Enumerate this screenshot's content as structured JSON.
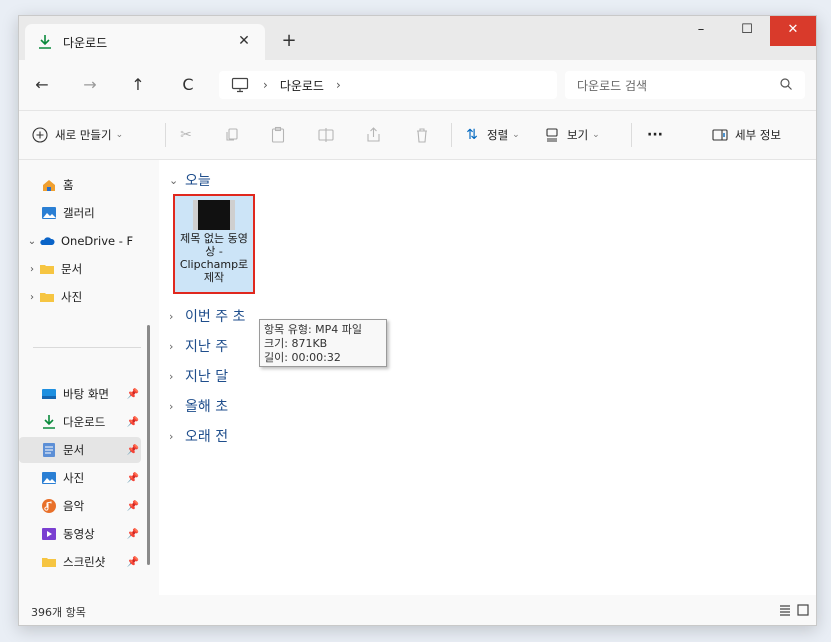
{
  "tab": {
    "title": "다운로드",
    "close": "✕",
    "new_tab": "+"
  },
  "window_controls": {
    "minimize": "–",
    "maximize": "☐",
    "close": "✕"
  },
  "nav": {
    "back": "←",
    "forward": "→",
    "up": "↑",
    "refresh": "C"
  },
  "address": {
    "sep1": "›",
    "crumb": "다운로드",
    "sep2": "›"
  },
  "search": {
    "placeholder": "다운로드 검색"
  },
  "commands": {
    "new": "새로 만들기",
    "sort": "정렬",
    "view": "보기",
    "more": "···",
    "details": "세부 정보"
  },
  "sidebar": {
    "items": [
      {
        "label": "홈"
      },
      {
        "label": "갤러리"
      },
      {
        "label": "OneDrive - F"
      },
      {
        "label": "문서"
      },
      {
        "label": "사진"
      },
      {
        "label": "바탕 화면"
      },
      {
        "label": "다운로드"
      },
      {
        "label": "문서"
      },
      {
        "label": "사진"
      },
      {
        "label": "음악"
      },
      {
        "label": "동영상"
      },
      {
        "label": "스크린샷"
      }
    ]
  },
  "groups": [
    {
      "label": "오늘"
    },
    {
      "label": "이번 주 초"
    },
    {
      "label": "지난 주"
    },
    {
      "label": "지난 달"
    },
    {
      "label": "올해 초"
    },
    {
      "label": "오래 전"
    }
  ],
  "file": {
    "name": "제목 없는 동영상 - Clipchamp로 제작"
  },
  "tooltip": {
    "type": "항목 유형: MP4 파일",
    "size": "크기: 871KB",
    "length": "길이: 00:00:32"
  },
  "status": {
    "count": "396개 항목"
  },
  "colors": {
    "accent": "#0067c0",
    "close": "#d93a2b",
    "selection": "#cce4f7",
    "highlight_border": "#e0281e"
  }
}
